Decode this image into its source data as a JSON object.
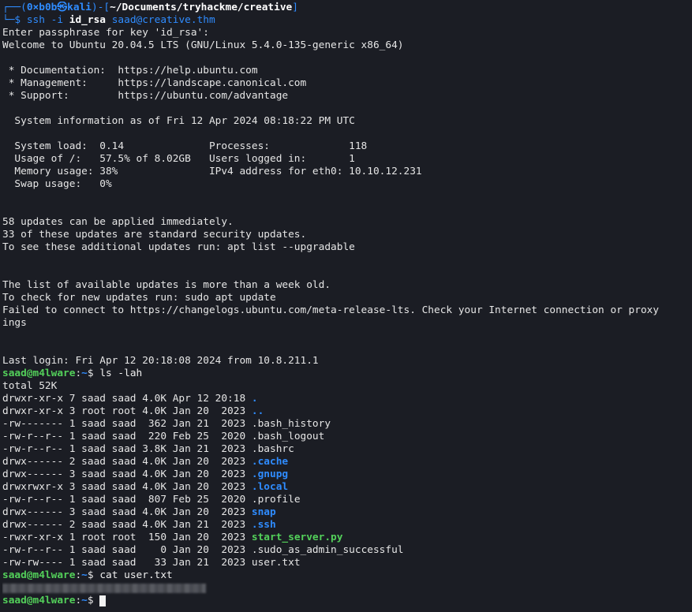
{
  "colors": {
    "background": "#1b1d24",
    "text": "#e6e6e6",
    "prompt_blue": "#2f8cff",
    "prompt_green": "#53d05a",
    "dir_blue": "#2f8cff",
    "exec_green": "#53d05a"
  },
  "prompt_header": {
    "corner_top": "┌──(",
    "user": "0×b0b",
    "skull": "㉿",
    "host": "kali",
    "sep": ")-[",
    "path": "~/Documents/tryhackme/creative",
    "close": "]",
    "corner_bottom": "└─$ ",
    "cmd_prefix": "ssh -i ",
    "cmd_key": "id_rsa",
    "cmd_rest": " saad@creative.thm"
  },
  "output_lines": [
    "Enter passphrase for key 'id_rsa':",
    "Welcome to Ubuntu 20.04.5 LTS (GNU/Linux 5.4.0-135-generic x86_64)",
    "",
    " * Documentation:  https://help.ubuntu.com",
    " * Management:     https://landscape.canonical.com",
    " * Support:        https://ubuntu.com/advantage",
    "",
    "  System information as of Fri 12 Apr 2024 08:18:22 PM UTC",
    "",
    "  System load:  0.14              Processes:             118",
    "  Usage of /:   57.5% of 8.02GB   Users logged in:       1",
    "  Memory usage: 38%               IPv4 address for eth0: 10.10.12.231",
    "  Swap usage:   0%",
    "",
    "",
    "58 updates can be applied immediately.",
    "33 of these updates are standard security updates.",
    "To see these additional updates run: apt list --upgradable",
    "",
    "",
    "The list of available updates is more than a week old.",
    "To check for new updates run: sudo apt update",
    "Failed to connect to https://changelogs.ubuntu.com/meta-release-lts. Check your Internet connection or proxy",
    "ings",
    "",
    "",
    "Last login: Fri Apr 12 20:18:08 2024 from 10.8.211.1"
  ],
  "remote_prompt": {
    "user_host": "saad@m4lware",
    "colon": ":",
    "path": "~",
    "dollar": "$ "
  },
  "ls_command": "ls -lah",
  "ls_total": "total 52K",
  "ls_rows": [
    {
      "meta": "drwxr-xr-x 7 saad saad 4.0K Apr 12 20:18 ",
      "name": ".",
      "kind": "dir"
    },
    {
      "meta": "drwxr-xr-x 3 root root 4.0K Jan 20  2023 ",
      "name": "..",
      "kind": "dir"
    },
    {
      "meta": "-rw------- 1 saad saad  362 Jan 21  2023 ",
      "name": ".bash_history",
      "kind": "file"
    },
    {
      "meta": "-rw-r--r-- 1 saad saad  220 Feb 25  2020 ",
      "name": ".bash_logout",
      "kind": "file"
    },
    {
      "meta": "-rw-r--r-- 1 saad saad 3.8K Jan 21  2023 ",
      "name": ".bashrc",
      "kind": "file"
    },
    {
      "meta": "drwx------ 2 saad saad 4.0K Jan 20  2023 ",
      "name": ".cache",
      "kind": "dir"
    },
    {
      "meta": "drwx------ 3 saad saad 4.0K Jan 20  2023 ",
      "name": ".gnupg",
      "kind": "dir"
    },
    {
      "meta": "drwxrwxr-x 3 saad saad 4.0K Jan 20  2023 ",
      "name": ".local",
      "kind": "dir"
    },
    {
      "meta": "-rw-r--r-- 1 saad saad  807 Feb 25  2020 ",
      "name": ".profile",
      "kind": "file"
    },
    {
      "meta": "drwx------ 3 saad saad 4.0K Jan 20  2023 ",
      "name": "snap",
      "kind": "dir"
    },
    {
      "meta": "drwx------ 2 saad saad 4.0K Jan 21  2023 ",
      "name": ".ssh",
      "kind": "dir"
    },
    {
      "meta": "-rwxr-xr-x 1 root root  150 Jan 20  2023 ",
      "name": "start_server.py",
      "kind": "exec"
    },
    {
      "meta": "-rw-r--r-- 1 saad saad    0 Jan 20  2023 ",
      "name": ".sudo_as_admin_successful",
      "kind": "file"
    },
    {
      "meta": "-rw-rw---- 1 saad saad   33 Jan 21  2023 ",
      "name": "user.txt",
      "kind": "file"
    }
  ],
  "cat_command": "cat user.txt"
}
